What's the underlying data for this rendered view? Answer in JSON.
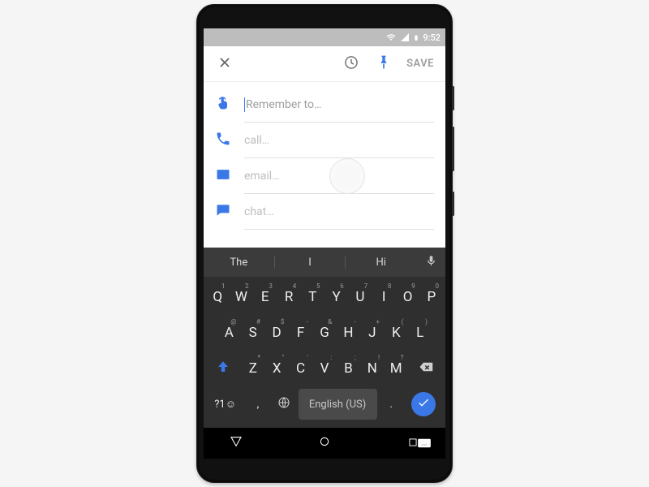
{
  "status": {
    "time": "9:52"
  },
  "toolbar": {
    "save_label": "SAVE"
  },
  "suggestions": {
    "remember": "Remember to…",
    "call": "call…",
    "email": "email…",
    "chat": "chat…"
  },
  "keyboard": {
    "predictions": [
      "The",
      "I",
      "Hi"
    ],
    "row1": [
      {
        "main": "Q",
        "hint": "1"
      },
      {
        "main": "W",
        "hint": "2"
      },
      {
        "main": "E",
        "hint": "3"
      },
      {
        "main": "R",
        "hint": "4"
      },
      {
        "main": "T",
        "hint": "5"
      },
      {
        "main": "Y",
        "hint": "6"
      },
      {
        "main": "U",
        "hint": "7"
      },
      {
        "main": "I",
        "hint": "8"
      },
      {
        "main": "O",
        "hint": "9"
      },
      {
        "main": "P",
        "hint": "0"
      }
    ],
    "row2": [
      {
        "main": "A",
        "hint": "@"
      },
      {
        "main": "S",
        "hint": "#"
      },
      {
        "main": "D",
        "hint": "$"
      },
      {
        "main": "F",
        "hint": "‑"
      },
      {
        "main": "G",
        "hint": "&"
      },
      {
        "main": "H",
        "hint": "-"
      },
      {
        "main": "J",
        "hint": "+"
      },
      {
        "main": "K",
        "hint": "("
      },
      {
        "main": "L",
        "hint": ")"
      }
    ],
    "row3": [
      {
        "main": "Z",
        "hint": "*"
      },
      {
        "main": "X",
        "hint": "\""
      },
      {
        "main": "C",
        "hint": "'"
      },
      {
        "main": "V",
        "hint": ":"
      },
      {
        "main": "B",
        "hint": ";"
      },
      {
        "main": "N",
        "hint": "!"
      },
      {
        "main": "M",
        "hint": "?"
      }
    ],
    "symbols_key": "?1☺",
    "comma": ",",
    "period": ".",
    "space_label": "English (US)"
  }
}
